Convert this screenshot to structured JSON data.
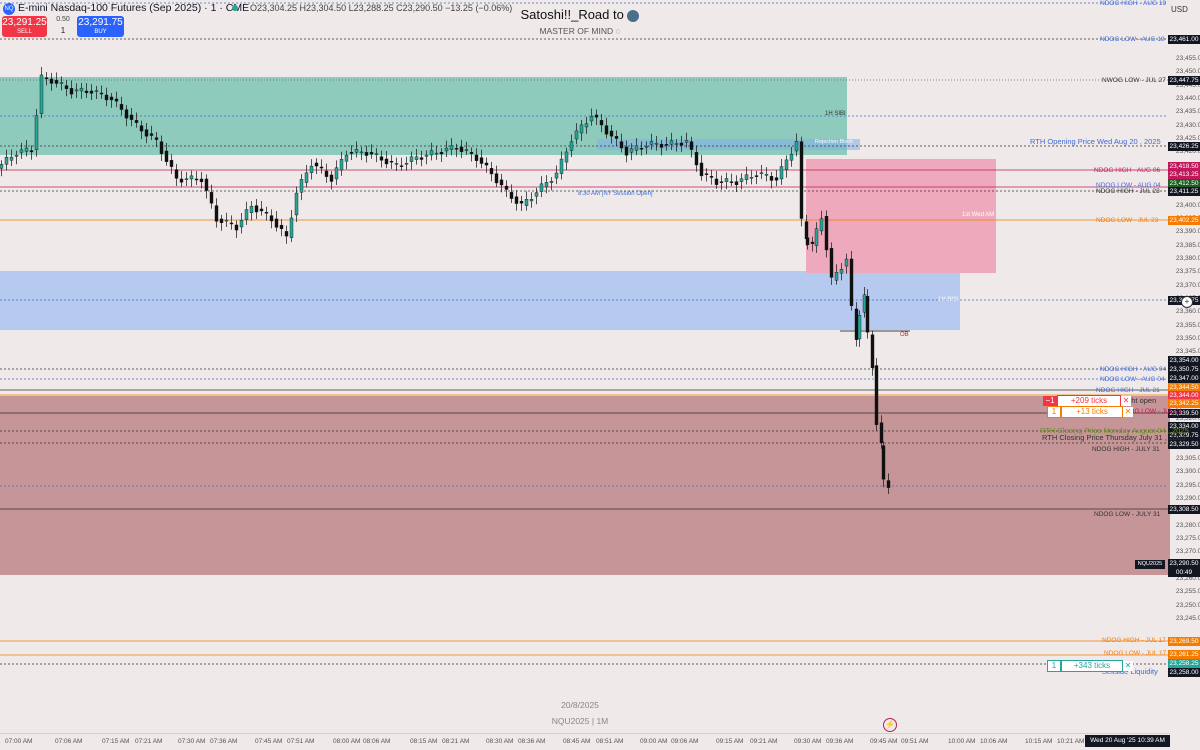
{
  "header": {
    "logo_text": "NQ",
    "symbol_title": "E-mini Nasdaq-100 Futures (Sep 2025) · 1 · CME",
    "ohlc": "O23,304.25 H23,304.50 L23,288.25 C23,290.50 −13.25 (−0.06%)",
    "sell_price": "23,291.25",
    "sell_label": "SELL",
    "buy_price": "23,291.75",
    "buy_label": "BUY",
    "spread": "0.50",
    "quantity": "1",
    "chart_title": "Satoshi!!_Road to",
    "chart_subtitle": "MASTER OF MIND",
    "currency": "USD"
  },
  "colors": {
    "up": "#26a69a",
    "down": "#111111",
    "green_zone": "#8ecbbd",
    "blue_zone": "#b6c9ee",
    "red_zone": "#c59597",
    "pink_zone": "#efa9bc",
    "bg": "#efe9e9"
  },
  "price_axis": {
    "ticks": [
      "23,455.00",
      "23,450.00",
      "23,445.00",
      "23,440.00",
      "23,435.00",
      "23,430.00",
      "23,425.00",
      "23,420.00",
      "23,415.00",
      "23,410.00",
      "23,405.00",
      "23,400.00",
      "23,395.00",
      "23,390.00",
      "23,385.00",
      "23,380.00",
      "23,375.00",
      "23,370.00",
      "23,365.00",
      "23,360.00",
      "23,355.00",
      "23,350.00",
      "23,345.00",
      "23,340.00",
      "23,335.00",
      "23,330.00",
      "23,325.00",
      "23,320.00",
      "23,315.00",
      "23,310.00",
      "23,305.00",
      "23,300.00",
      "23,295.00",
      "23,290.00",
      "23,285.00",
      "23,280.00",
      "23,275.00",
      "23,270.00",
      "23,265.00",
      "23,260.00",
      "23,255.00",
      "23,250.00",
      "23,245.00"
    ],
    "tags": [
      {
        "text": "23,461.00",
        "color": "#131722"
      },
      {
        "text": "23,447.75",
        "color": "#131722"
      },
      {
        "text": "23,426.25",
        "color": "#131722"
      },
      {
        "text": "23,418.50",
        "color": "#c2185b"
      },
      {
        "text": "23,413.25",
        "color": "#c2185b"
      },
      {
        "text": "23,412.50",
        "color": "#1b5e20"
      },
      {
        "text": "23,411.25",
        "color": "#131722"
      },
      {
        "text": "23,402.25",
        "color": "#f57c00"
      },
      {
        "text": "23,375.75",
        "color": "#131722"
      },
      {
        "text": "23,354.00",
        "color": "#131722"
      },
      {
        "text": "23,350.75",
        "color": "#131722"
      },
      {
        "text": "23,347.00",
        "color": "#131722"
      },
      {
        "text": "23,344.50",
        "color": "#f57c00"
      },
      {
        "text": "23,344.00",
        "color": "#f23645"
      },
      {
        "text": "23,342.25",
        "color": "#f57c00"
      },
      {
        "text": "23,339.50",
        "color": "#131722"
      },
      {
        "text": "23,334.00",
        "color": "#131722"
      },
      {
        "text": "23,329.75",
        "color": "#131722"
      },
      {
        "text": "23,329.50",
        "color": "#131722"
      },
      {
        "text": "23,308.50",
        "color": "#131722"
      },
      {
        "text": "23,290.50",
        "color": "#131722"
      },
      {
        "text": "23,269.50",
        "color": "#f57c00"
      },
      {
        "text": "23,261.25",
        "color": "#f57c00"
      },
      {
        "text": "23,258.25",
        "color": "#26a69a"
      },
      {
        "text": "23,258.00",
        "color": "#131722"
      }
    ],
    "countdown": "00:49",
    "symbol_tag": "NQU2025"
  },
  "levels": [
    {
      "label": "NDOG HIGH - AUG 19",
      "color": "#3f6bd6",
      "price": 23464.5
    },
    {
      "label": "NDOG LOW - AUG 19",
      "color": "#3f6bd6",
      "price": 23461.0
    },
    {
      "label": "NWOG LOW - JUL 27",
      "color": "#333333",
      "price": 23447.75
    },
    {
      "label": "RTH Opening Price Wed Aug 20 , 2025",
      "color": "#3f6bd6",
      "price": 23426.25
    },
    {
      "label": "NDOG HIGH - AUG 06",
      "color": "#c2185b",
      "price": 23413.25
    },
    {
      "label": "NDOG LOW - AUG 04",
      "color": "#3f6bd6",
      "price": 23411.25
    },
    {
      "label": "NDOG HIGH - JUL 23",
      "color": "#333333",
      "price": 23410.5
    },
    {
      "label": "NDOG LOW - JUL 23",
      "color": "#f57c00",
      "price": 23402.25
    },
    {
      "label": "NDOG HIGH - AUG 04",
      "color": "#3f6bd6",
      "price": 23350.75
    },
    {
      "label": "NDOG LOW - AUG 04",
      "color": "#3f6bd6",
      "price": 23347.0
    },
    {
      "label": "NDOG HIGH - JUL 21",
      "color": "#3f6bd6",
      "price": 23344.5
    },
    {
      "label": "Night open",
      "color": "#333333",
      "price": 23342.25
    },
    {
      "label": "NDOG LOW - JUL 21",
      "color": "#c2185b",
      "price": 23339.5
    },
    {
      "label": "RTH Closing Price Monday August 04 , 2025",
      "color": "#6b8e23",
      "price": 23334.0
    },
    {
      "label": "RTH Closing Price Thursday July 31 , 2025",
      "color": "#333333",
      "price": 23329.75
    },
    {
      "label": "NDOG HIGH - JULY 31",
      "color": "#333333",
      "price": 23329.5
    },
    {
      "label": "NDOG LOW - JULY 31",
      "color": "#333333",
      "price": 23308.5
    },
    {
      "label": "NDOG HIGH - JUL 17",
      "color": "#f57c00",
      "price": 23269.5
    },
    {
      "label": "NDOG LOW - JUL 17",
      "color": "#f57c00",
      "price": 23261.25
    },
    {
      "label": "Sellside Liquidity",
      "color": "#3f6bd6",
      "price": 23258.0
    }
  ],
  "zone_labels": {
    "green": "1H SIBI",
    "blue": "1H BISI",
    "pink": "1st Wed AM",
    "session": "8:30 AM [NY Session Open]",
    "rejection": "Rejection Block",
    "ob": "OB"
  },
  "orders": [
    {
      "qty": "−1",
      "ticks": "+209 ticks",
      "close": "✕",
      "color": "#f23645"
    },
    {
      "qty": "1",
      "ticks": "+13 ticks",
      "close": "✕",
      "color": "#f57c00"
    },
    {
      "qty": "1",
      "ticks": "+343 ticks",
      "close": "✕",
      "color": "#26a69a"
    }
  ],
  "time_axis": {
    "labels": [
      "07:00 AM",
      "07:06 AM",
      "07:15 AM",
      "07:21 AM",
      "07:30 AM",
      "07:36 AM",
      "07:45 AM",
      "07:51 AM",
      "08:00 AM",
      "08:06 AM",
      "08:15 AM",
      "08:21 AM",
      "08:30 AM",
      "08:36 AM",
      "08:45 AM",
      "08:51 AM",
      "09:00 AM",
      "09:06 AM",
      "09:15 AM",
      "09:21 AM",
      "09:30 AM",
      "09:36 AM",
      "09:45 AM",
      "09:51 AM",
      "10:00 AM",
      "10:06 AM",
      "10:15 AM",
      "10:21 AM"
    ],
    "current": "Wed 20 Aug '25    10:39 AM"
  },
  "watermark": {
    "date": "20/8/2025",
    "symbol": "NQU2025 | 1M"
  },
  "icons": {
    "logo": "nq-logo-icon",
    "crosshair": "crosshair-add-icon",
    "chat": "chat-bubble-icon",
    "snake": "snake-icon"
  }
}
